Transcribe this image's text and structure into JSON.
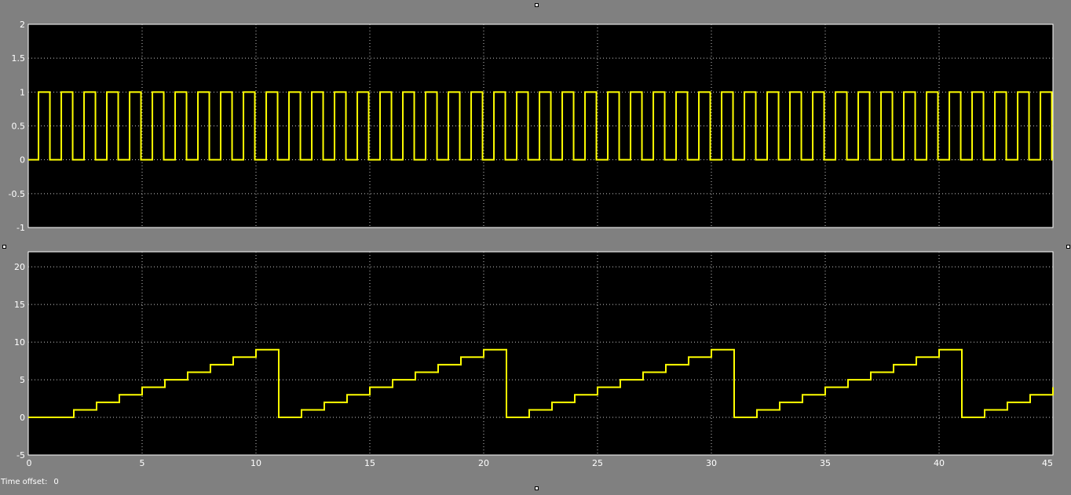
{
  "chart_data": [
    {
      "type": "line",
      "title": "",
      "xlabel": "",
      "ylabel": "",
      "xlim": [
        0,
        45
      ],
      "ylim": [
        -1,
        2
      ],
      "x_ticks": [
        0,
        5,
        10,
        15,
        20,
        25,
        30,
        35,
        40,
        45
      ],
      "x_tick_labels": [],
      "y_ticks": [
        -1,
        -0.5,
        0,
        0.5,
        1,
        1.5,
        2
      ],
      "y_tick_labels": [
        "-1",
        "-0.5",
        "0",
        "0.5",
        "1",
        "1.5",
        "2"
      ],
      "grid": true,
      "series": [
        {
          "color": "#ffff00",
          "signal": "square_wave",
          "period": 1,
          "duty_cycle": 0.5,
          "low": 0,
          "high": 1,
          "first_rise_x": 0.45
        }
      ]
    },
    {
      "type": "line",
      "title": "",
      "xlabel": "",
      "ylabel": "",
      "xlim": [
        0,
        45
      ],
      "ylim": [
        -5,
        22
      ],
      "x_ticks": [
        0,
        5,
        10,
        15,
        20,
        25,
        30,
        35,
        40,
        45
      ],
      "x_tick_labels": [
        "0",
        "5",
        "10",
        "15",
        "20",
        "25",
        "30",
        "35",
        "40",
        "45"
      ],
      "y_ticks": [
        -5,
        0,
        5,
        10,
        15,
        20
      ],
      "y_tick_labels": [
        "-5",
        "0",
        "5",
        "10",
        "15",
        "20"
      ],
      "grid": true,
      "series": [
        {
          "color": "#ffff00",
          "signal": "staircase_step",
          "x": [
            0,
            2,
            3,
            4,
            5,
            6,
            7,
            8,
            9,
            10,
            11,
            12,
            13,
            14,
            15,
            16,
            17,
            18,
            19,
            20,
            21,
            22,
            23,
            24,
            25,
            26,
            27,
            28,
            29,
            30,
            31,
            32,
            33,
            34,
            35,
            36,
            37,
            38,
            39,
            40,
            41,
            42,
            43,
            44,
            45
          ],
          "y": [
            0,
            1,
            2,
            3,
            4,
            5,
            6,
            7,
            8,
            9,
            0,
            1,
            2,
            3,
            4,
            5,
            6,
            7,
            8,
            9,
            0,
            1,
            2,
            3,
            4,
            5,
            6,
            7,
            8,
            9,
            0,
            1,
            2,
            3,
            4,
            5,
            6,
            7,
            8,
            9,
            0,
            1,
            2,
            3,
            4
          ]
        }
      ]
    }
  ],
  "footer": {
    "time_offset_label": "Time offset:",
    "time_offset_value": "0"
  }
}
